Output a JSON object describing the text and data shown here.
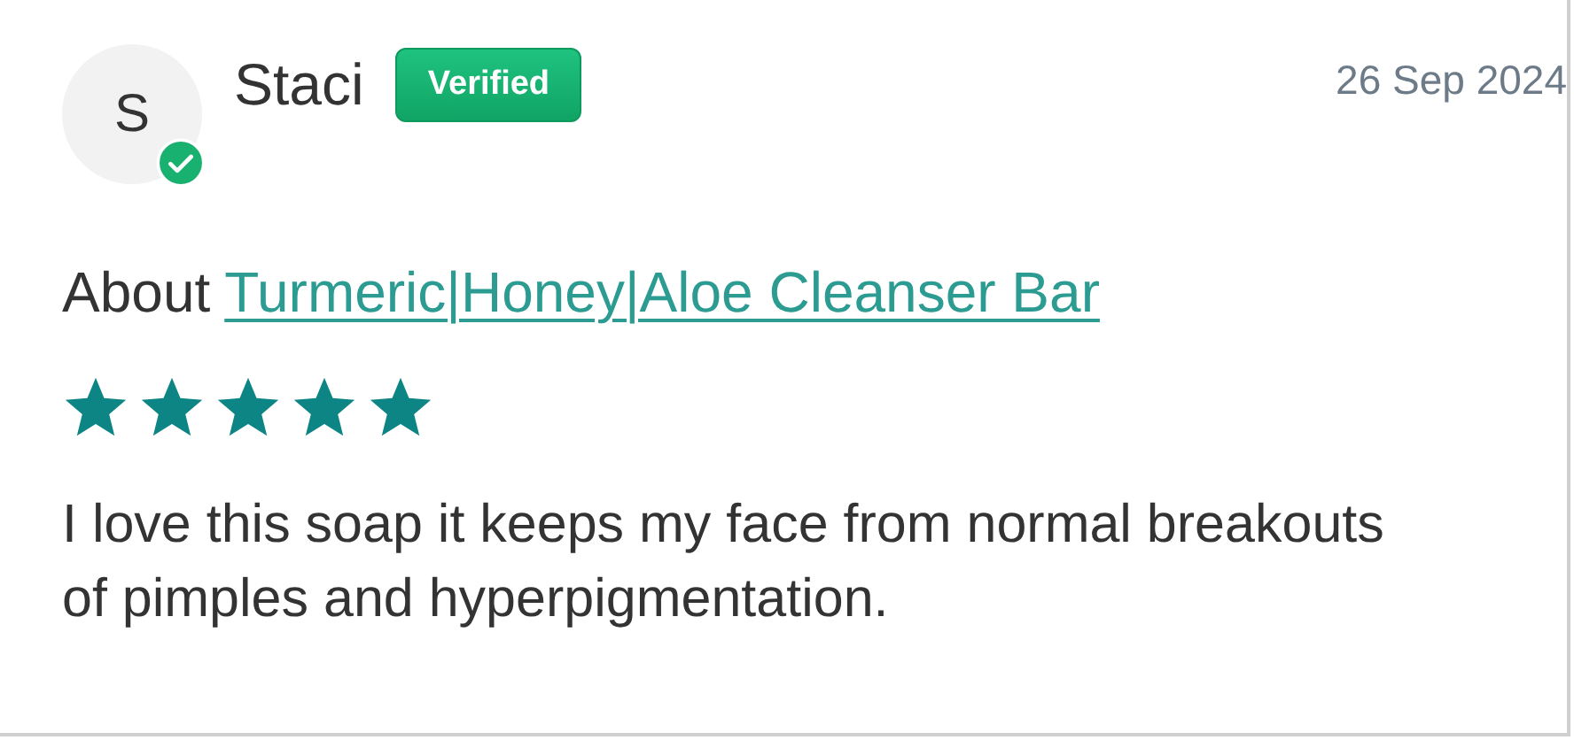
{
  "review": {
    "avatar_letter": "S",
    "verified": true,
    "author": "Staci",
    "badge": "Verified",
    "date": "26 Sep 2024",
    "about_label": "About",
    "product": "Turmeric|Honey|Aloe Cleanser Bar",
    "stars": 5,
    "text": "I love this soap it keeps my face from normal breakouts of pimples and hyperpigmentation."
  }
}
